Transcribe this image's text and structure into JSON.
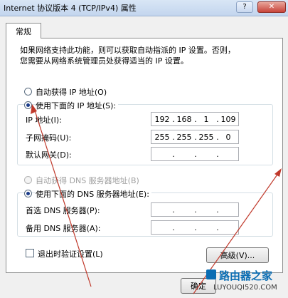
{
  "window": {
    "title": "Internet 协议版本 4 (TCP/IPv4) 属性",
    "help_label": "?",
    "close_label": "✕"
  },
  "tab": {
    "label": "常规"
  },
  "description": {
    "line1": "如果网络支持此功能，则可以获取自动指派的 IP 设置。否则，",
    "line2": "您需要从网络系统管理员处获得适当的 IP 设置。"
  },
  "ip_section": {
    "auto_label": "自动获得 IP 地址(O)",
    "manual_label": "使用下面的 IP 地址(S):",
    "auto_selected": false,
    "fields": [
      {
        "label": "IP 地址(I):",
        "octets": [
          "192",
          "168",
          "1",
          "109"
        ]
      },
      {
        "label": "子网掩码(U):",
        "octets": [
          "255",
          "255",
          "255",
          "0"
        ]
      },
      {
        "label": "默认网关(D):",
        "octets": [
          "",
          "",
          "",
          ""
        ]
      }
    ]
  },
  "dns_section": {
    "auto_label": "自动获得 DNS 服务器地址(B)",
    "manual_label": "使用下面的 DNS 服务器地址(E):",
    "fields": [
      {
        "label": "首选 DNS 服务器(P):",
        "octets": [
          "",
          "",
          "",
          ""
        ]
      },
      {
        "label": "备用 DNS 服务器(A):",
        "octets": [
          "",
          "",
          "",
          ""
        ]
      }
    ]
  },
  "validate": {
    "label": "退出时验证设置(L)",
    "checked": false
  },
  "buttons": {
    "advanced": "高级(V)...",
    "ok": "确定"
  },
  "watermark": {
    "main": "路由器之家",
    "url": "LUYOUQI520.COM"
  },
  "colors": {
    "arrow": "#c0392b",
    "selection": "#1a3b8a",
    "watermark": "#0b6db3"
  }
}
